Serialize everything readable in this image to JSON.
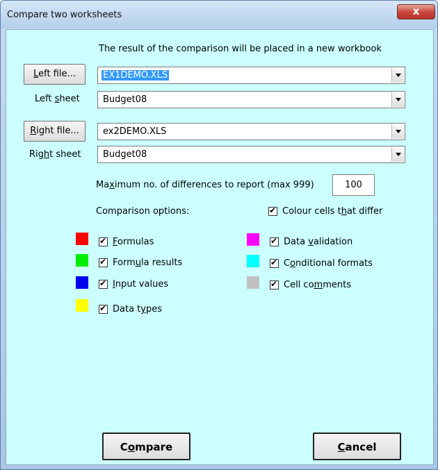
{
  "window": {
    "title": "Compare two worksheets",
    "close_label": "x"
  },
  "heading": "The result of the comparison will be placed in a new workbook",
  "left": {
    "file_button": {
      "pre": "",
      "key": "L",
      "post": "eft file..."
    },
    "file_value": "EX1DEMO.XLS",
    "sheet_label": {
      "pre": "Left ",
      "key": "s",
      "post": "heet"
    },
    "sheet_value": "Budget08"
  },
  "right": {
    "file_button": {
      "pre": "",
      "key": "R",
      "post": "ight file..."
    },
    "file_value": "ex2DEMO.XLS",
    "sheet_label": {
      "pre": "Rig",
      "key": "h",
      "post": "t sheet"
    },
    "sheet_value": "Budget08"
  },
  "max_diff": {
    "label": {
      "pre": "Ma",
      "key": "x",
      "post": "imum no. of differences to report (max 999)"
    },
    "value": "100"
  },
  "comparison_options_label": "Comparison options:",
  "colour_cells": {
    "pre": "Colour cells t",
    "key": "h",
    "post": "at differ",
    "checked": true
  },
  "options": [
    {
      "id": "formulas",
      "pre": "",
      "key": "F",
      "post": "ormulas",
      "color": "#ff0000",
      "checked": true
    },
    {
      "id": "formula-results",
      "pre": "Form",
      "key": "u",
      "post": "la results",
      "color": "#00ee00",
      "checked": true
    },
    {
      "id": "input-values",
      "pre": "",
      "key": "I",
      "post": "nput values",
      "color": "#0000ee",
      "checked": true
    },
    {
      "id": "data-types",
      "pre": "Data t",
      "key": "y",
      "post": "pes",
      "color": "#ffff00",
      "checked": true
    },
    {
      "id": "data-validation",
      "pre": "Data ",
      "key": "v",
      "post": "alidation",
      "color": "#ff00ff",
      "checked": true
    },
    {
      "id": "conditional-formats",
      "pre": "C",
      "key": "o",
      "post": "nditional formats",
      "color": "#00ffff",
      "checked": true
    },
    {
      "id": "cell-comments",
      "pre": "Cell co",
      "key": "m",
      "post": "ments",
      "color": "#c0c0c0",
      "checked": true
    }
  ],
  "buttons": {
    "compare": {
      "pre": "C",
      "key": "o",
      "post": "mpare"
    },
    "cancel": {
      "pre": "",
      "key": "C",
      "post": "ancel"
    }
  }
}
